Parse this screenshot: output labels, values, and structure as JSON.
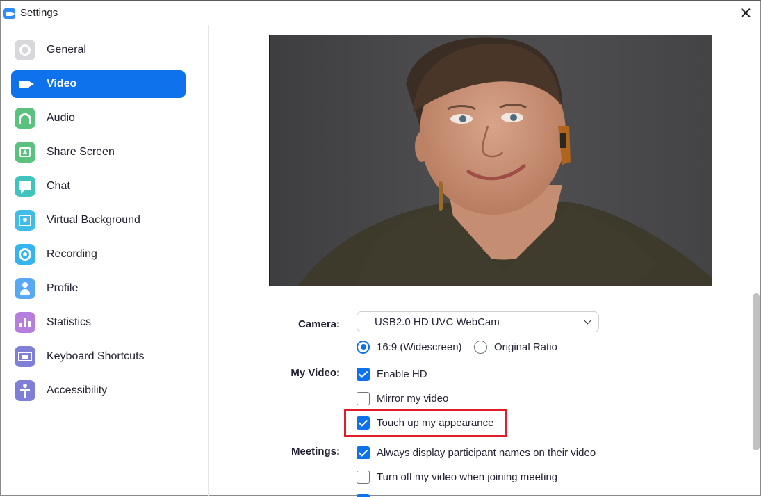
{
  "window": {
    "title": "Settings"
  },
  "sidebar": {
    "items": [
      {
        "label": "General",
        "icon": "gear-icon",
        "color": "#d8d8dc",
        "active": false
      },
      {
        "label": "Video",
        "icon": "video-camera-icon",
        "color": "#0e72ed",
        "active": true
      },
      {
        "label": "Audio",
        "icon": "headphones-icon",
        "color": "#5bc17f",
        "active": false
      },
      {
        "label": "Share Screen",
        "icon": "share-screen-icon",
        "color": "#5bc17f",
        "active": false
      },
      {
        "label": "Chat",
        "icon": "chat-icon",
        "color": "#40c4bd",
        "active": false
      },
      {
        "label": "Virtual Background",
        "icon": "virtual-background-icon",
        "color": "#3fbde6",
        "active": false
      },
      {
        "label": "Recording",
        "icon": "recording-icon",
        "color": "#35b4ef",
        "active": false
      },
      {
        "label": "Profile",
        "icon": "profile-icon",
        "color": "#58a9f4",
        "active": false
      },
      {
        "label": "Statistics",
        "icon": "statistics-icon",
        "color": "#b57fe0",
        "active": false
      },
      {
        "label": "Keyboard Shortcuts",
        "icon": "keyboard-icon",
        "color": "#7f7fd8",
        "active": false
      },
      {
        "label": "Accessibility",
        "icon": "accessibility-icon",
        "color": "#7f7fd8",
        "active": false
      }
    ]
  },
  "video": {
    "camera_label": "Camera:",
    "camera_value": "USB2.0 HD UVC WebCam",
    "ratio_options": [
      {
        "label": "16:9 (Widescreen)",
        "selected": true
      },
      {
        "label": "Original Ratio",
        "selected": false
      }
    ],
    "my_video_label": "My Video:",
    "my_video_options": [
      {
        "label": "Enable HD",
        "checked": true
      },
      {
        "label": "Mirror my video",
        "checked": false
      },
      {
        "label": "Touch up my appearance",
        "checked": true,
        "highlighted": true
      }
    ],
    "meetings_label": "Meetings:",
    "meetings_options": [
      {
        "label": "Always display participant names on their video",
        "checked": true
      },
      {
        "label": "Turn off my video when joining meeting",
        "checked": false
      }
    ]
  },
  "colors": {
    "accent": "#0e72ed",
    "highlight": "#e11d2b"
  }
}
